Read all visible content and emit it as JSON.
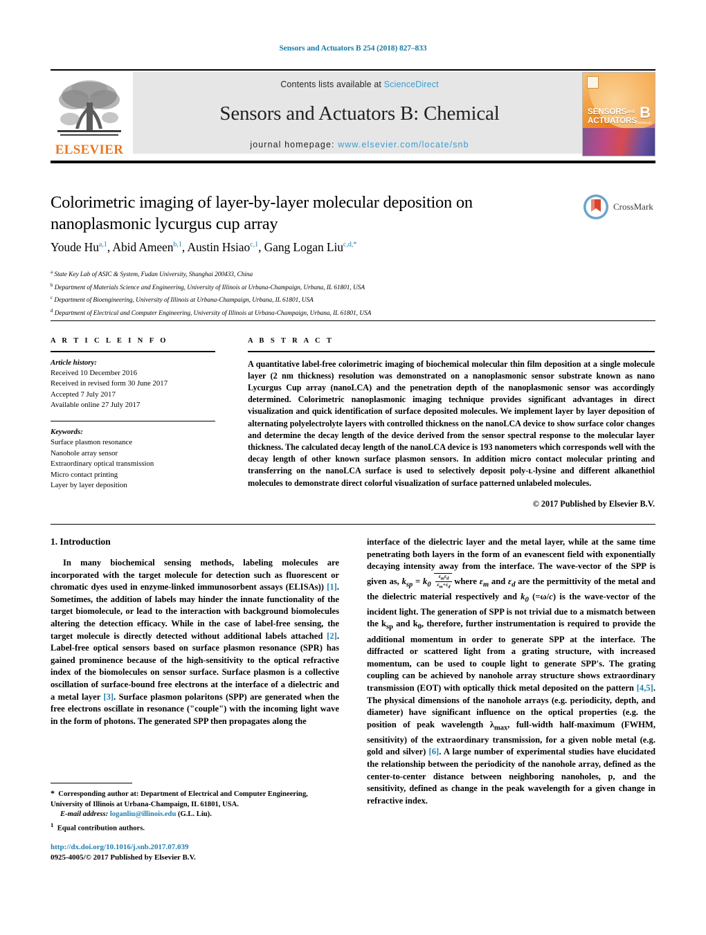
{
  "running_head": "Sensors and Actuators B 254 (2018) 827–833",
  "masthead": {
    "contents_prefix": "Contents lists available at ",
    "sciencedirect": "ScienceDirect",
    "journal_title": "Sensors and Actuators B: Chemical",
    "homepage_prefix": "journal homepage: ",
    "homepage_url": "www.elsevier.com/locate/snb",
    "publisher": "ELSEVIER",
    "cover": {
      "line1": "SENSORS",
      "line1_small": "and",
      "line2": "ACTUATORS",
      "letter": "B",
      "sub": "Chemical"
    },
    "colors": {
      "link": "#3a9bd2",
      "elsevier_orange": "#e87722",
      "panel_bg": "#e6e6e6"
    }
  },
  "crossmark": {
    "label": "CrossMark"
  },
  "article": {
    "title": "Colorimetric imaging of layer-by-layer molecular deposition on nanoplasmonic lycurgus cup array",
    "authors_html": "Youde Hu<sup>a,1</sup>, Abid Ameen<sup>b,1</sup>, Austin Hsiao<sup>c,1</sup>, Gang Logan Liu<sup>c,d,</sup><sup>*</sup>",
    "affiliations": [
      {
        "marker": "a",
        "text": "State Key Lab of ASIC & System, Fudan University, Shanghai 200433, China"
      },
      {
        "marker": "b",
        "text": "Department of Materials Science and Engineering, University of Illinois at Urbana-Champaign, Urbana, IL 61801, USA"
      },
      {
        "marker": "c",
        "text": "Department of Bioengineering, University of Illinois at Urbana-Champaign, Urbana, IL 61801, USA"
      },
      {
        "marker": "d",
        "text": "Department of Electrical and Computer Engineering, University of Illinois at Urbana-Champaign, Urbana, IL 61801, USA"
      }
    ]
  },
  "article_info": {
    "heading": "A R T I C L E   I N F O",
    "history_label": "Article history:",
    "history": [
      "Received 10 December 2016",
      "Received in revised form 30 June 2017",
      "Accepted 7 July 2017",
      "Available online 27 July 2017"
    ],
    "keywords_label": "Keywords:",
    "keywords": [
      "Surface plasmon resonance",
      "Nanohole array sensor",
      "Extraordinary optical transmission",
      "Micro contact printing",
      "Layer by layer deposition"
    ]
  },
  "abstract": {
    "heading": "A B S T R A C T",
    "text": "A quantitative label-free colorimetric imaging of biochemical molecular thin film deposition at a single molecule layer (2 nm thickness) resolution was demonstrated on a nanoplasmonic sensor substrate known as nano Lycurgus Cup array (nanoLCA) and the penetration depth of the nanoplasmonic sensor was accordingly determined. Colorimetric nanoplasmonic imaging technique provides significant advantages in direct visualization and quick identification of surface deposited molecules. We implement layer by layer deposition of alternating polyelectrolyte layers with controlled thickness on the nanoLCA device to show surface color changes and determine the decay length of the device derived from the sensor spectral response to the molecular layer thickness. The calculated decay length of the nanoLCA device is 193 nanometers which corresponds well with the decay length of other known surface plasmon sensors. In addition micro contact molecular printing and transferring on the nanoLCA surface is used to selectively deposit poly-ʟ-lysine and different alkanethiol molecules to demonstrate direct colorful visualization of surface patterned unlabeled molecules.",
    "copyright": "© 2017 Published by Elsevier B.V."
  },
  "body": {
    "section_number_title": "1.  Introduction",
    "left_paragraph_html": "In many biochemical sensing methods, labeling molecules are incorporated with the target molecule for detection such as fluorescent or chromatic dyes used in enzyme-linked immunosorbent assays (ELISAs)) <span class=\"ref\">[1]</span>. Sometimes, the addition of labels may hinder the innate functionality of the target biomolecule, or lead to the interaction with background biomolecules altering the detection efficacy. While in the case of label-free sensing, the target molecule is directly detected without additional labels attached <span class=\"ref\">[2]</span>. Label-free optical sensors based on surface plasmon resonance (SPR) has gained prominence because of the high-sensitivity to the optical refractive index of the biomolecules on sensor surface. Surface plasmon is a collective oscillation of surface-bound free electrons at the interface of a dielectric and a metal layer <span class=\"ref\">[3]</span>. Surface plasmon polaritons (SPP) are generated when the free electrons oscillate in resonance (\"couple\") with the incoming light wave in the form of photons. The generated SPP then propagates along the",
    "right_paragraph_html": "interface of the dielectric layer and the metal layer, while at the same time penetrating both layers in the form of an evanescent field with exponentially decaying intensity away from the interface. The wave-vector of the SPP is given as, <em class=\"mathvar\">k<sub>sp</sub></em> = <em class=\"mathvar\">k<sub>0</sub></em> <span class=\"sqrt\"><span class=\"frac\"><span class=\"num\"><em>&#949;<sub>m</sub>&#949;<sub>d</sub></em></span><span class=\"den\"><em>&#949;<sub>m</sub>+&#949;<sub>d</sub></em></span></span></span> where <em class=\"mathvar\">&#949;<sub>m</sub></em> and <em class=\"mathvar\">&#949;<sub>d</sub></em> are the permittivity of the metal and the dielectric material respectively and <em class=\"mathvar\">k<sub>0</sub></em> (=&#969;/<em>c</em>) is the wave-vector of the incident light. The generation of SPP is not trivial due to a mismatch between the k<sub>sp</sub> and k<sub>0</sub>, therefore, further instrumentation is required to provide the additional momentum in order to generate SPP at the interface. The diffracted or scattered light from a grating structure, with increased momentum, can be used to couple light to generate SPP's. The grating coupling can be achieved by nanohole array structure shows extraordinary transmission (EOT) with optically thick metal deposited on the pattern <span class=\"ref\">[4,5]</span>. The physical dimensions of the nanohole arrays (e.g. periodicity, depth, and diameter) have significant influence on the optical properties (e.g. the position of peak wavelength &#955;<sub>max</sub>, full-width half-maximum (FWHM, sensitivity) of the extraordinary transmission, for a given noble metal (e.g. gold and silver) <span class=\"ref\">[6]</span>. A large number of experimental studies have elucidated the relationship between the periodicity of the nanohole array, defined as the center-to-center distance between neighboring nanoholes, p, and the sensitivity, defined as change in the peak wavelength for a given change in refractive index."
  },
  "footnotes": {
    "corresponding_html": "<span style=\"font-size:12px\">*</span>&nbsp; Corresponding author at: Department of Electrical and Computer Engineering, University of Illinois at Urbana-Champaign, IL 61801, USA.",
    "email_label": "E-mail address:",
    "email": "loganliu@illinois.edu",
    "email_suffix": "(G.L. Liu).",
    "equal_contribution_marker": "1",
    "equal_contribution": "Equal contribution authors."
  },
  "doi": {
    "url": "http://dx.doi.org/10.1016/j.snb.2017.07.039",
    "issn_line": "0925-4005/© 2017 Published by Elsevier B.V."
  }
}
